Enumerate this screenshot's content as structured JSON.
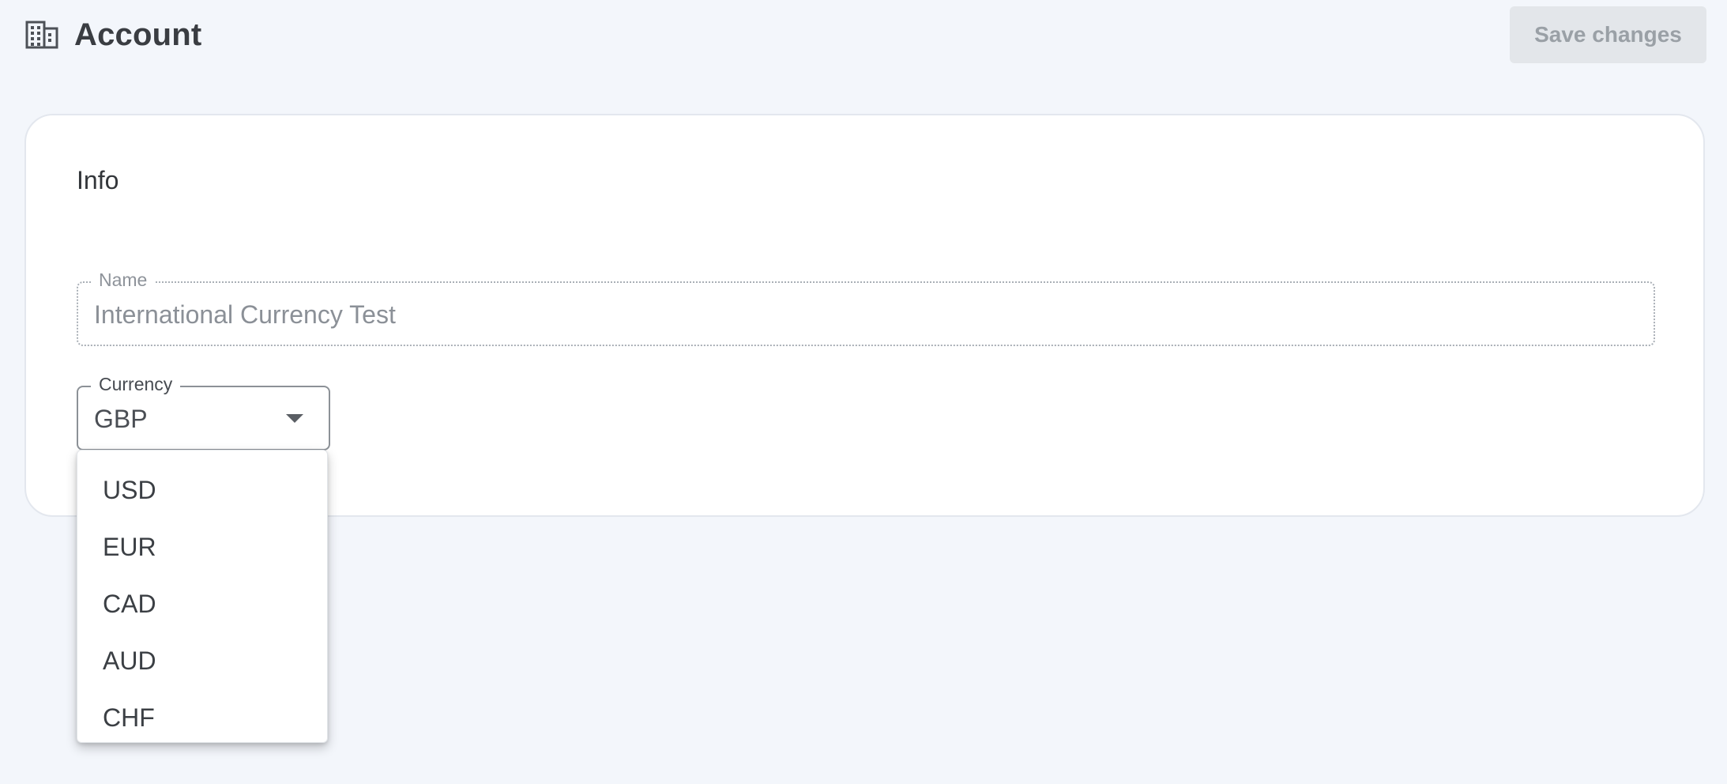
{
  "header": {
    "title": "Account",
    "icon": "building-icon",
    "save_label": "Save changes"
  },
  "card": {
    "section_title": "Info",
    "name_field": {
      "label": "Name",
      "value": "International Currency Test"
    },
    "currency_field": {
      "label": "Currency",
      "value": "GBP",
      "options": [
        "USD",
        "EUR",
        "CAD",
        "AUD",
        "CHF"
      ]
    }
  },
  "colors": {
    "background": "#f3f6fb",
    "card": "#ffffff",
    "disabled_button": "#e3e6ea",
    "disabled_text": "#9aa0a6"
  }
}
